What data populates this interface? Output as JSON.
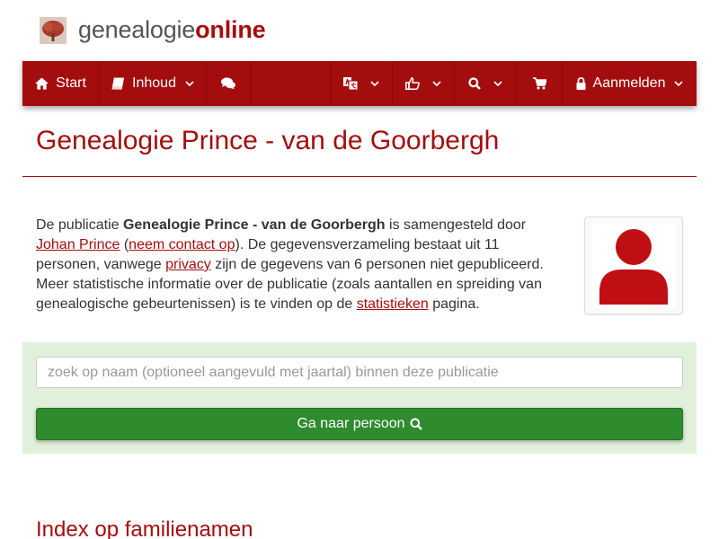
{
  "brand": {
    "part1": "genealogie",
    "part2": "online"
  },
  "nav": {
    "start_label": "Start",
    "inhoud_label": "Inhoud",
    "login_label": "Aanmelden"
  },
  "page": {
    "title": "Genealogie Prince - van de Goorbergh"
  },
  "intro": {
    "t1": "De publicatie ",
    "pub_name": "Genealogie Prince - van de Goorbergh",
    "t2": " is samengesteld door ",
    "author_link": "Johan Prince",
    "t3": " (",
    "contact_link": "neem contact op",
    "t4": "). De gegevensverzameling bestaat uit 11 personen, vanwege ",
    "privacy_link": "privacy",
    "t5": " zijn de gegevens van 6 personen niet gepubliceerd. Meer statistische informatie over de publicatie (zoals aantallen en spreiding van genealogische gebeurtenissen) is te vinden op de ",
    "stats_link": "statistieken",
    "t6": " pagina."
  },
  "search": {
    "placeholder": "zoek op naam (optioneel aangevuld met jaartal) binnen deze publicatie",
    "value": "",
    "button_label": "Ga naar persoon"
  },
  "index_section": {
    "heading": "Index op familienamen"
  },
  "colors": {
    "brand_red": "#a30d0d",
    "button_green": "#2e8b2e",
    "panel_green": "#e0f0da"
  },
  "icons": [
    "tree-logo-icon",
    "home-icon",
    "book-icon",
    "comments-icon",
    "translate-icon",
    "thumbs-up-icon",
    "search-icon",
    "cart-icon",
    "lock-icon",
    "user-avatar-icon"
  ]
}
